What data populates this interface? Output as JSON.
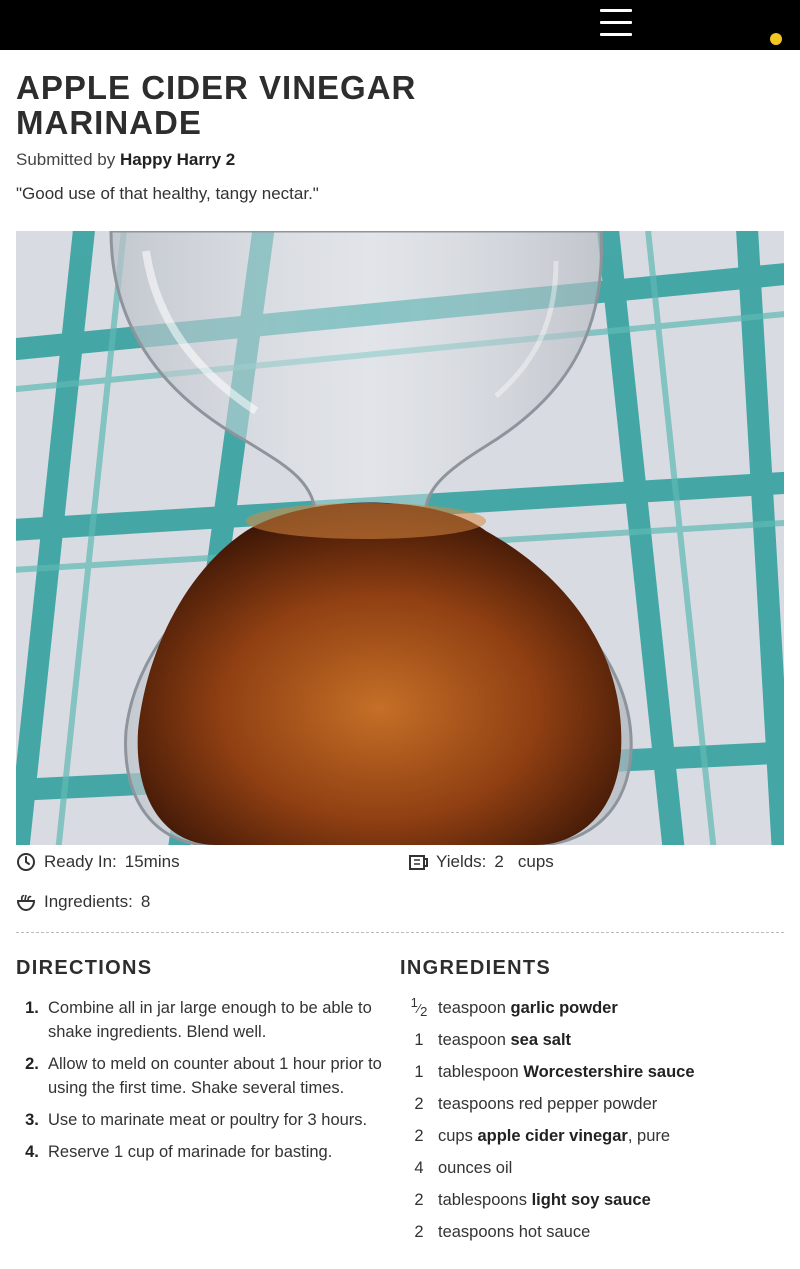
{
  "header": {
    "menu_icon": "hamburger-menu-icon",
    "notification_color": "#f2c623"
  },
  "recipe": {
    "title": "APPLE CIDER VINEGAR MARINADE",
    "submitted_prefix": "Submitted by",
    "author": "Happy Harry 2",
    "quote": "\"Good use of that healthy, tangy nectar.\"",
    "photo_icon": "recipe-photo"
  },
  "meta": {
    "ready_label": "Ready In:",
    "ready_value": "15mins",
    "yields_label": "Yields:",
    "yields_amount": "2",
    "yields_unit": "cups",
    "ingredients_label": "Ingredients:",
    "ingredients_value": "8"
  },
  "directions": {
    "heading": "DIRECTIONS",
    "steps": [
      {
        "num": "1.",
        "text": "Combine all in jar large enough to be able to shake ingredients. Blend well."
      },
      {
        "num": "2.",
        "text": "Allow to meld on counter about 1 hour prior to using the first time. Shake several times."
      },
      {
        "num": "3.",
        "text": "Use to marinate meat or poultry for 3 hours."
      },
      {
        "num": "4.",
        "text": "Reserve 1 cup of marinade for basting."
      }
    ]
  },
  "ingredients": {
    "heading": "INGREDIENTS",
    "items": [
      {
        "qty": "1/2",
        "unit": "teaspoon",
        "name": "garlic powder",
        "suffix": ""
      },
      {
        "qty": "1",
        "unit": "teaspoon",
        "name": "sea salt",
        "suffix": ""
      },
      {
        "qty": "1",
        "unit": "tablespoon",
        "name": "Worcestershire sauce",
        "suffix": ""
      },
      {
        "qty": "2",
        "unit": "teaspoons red pepper powder",
        "name": "",
        "suffix": ""
      },
      {
        "qty": "2",
        "unit": "cups",
        "name": "apple cider vinegar",
        "suffix": ", pure"
      },
      {
        "qty": "4",
        "unit": "ounces oil",
        "name": "",
        "suffix": ""
      },
      {
        "qty": "2",
        "unit": "tablespoons",
        "name": "light soy sauce",
        "suffix": ""
      },
      {
        "qty": "2",
        "unit": "teaspoons hot sauce",
        "name": "",
        "suffix": ""
      }
    ]
  }
}
